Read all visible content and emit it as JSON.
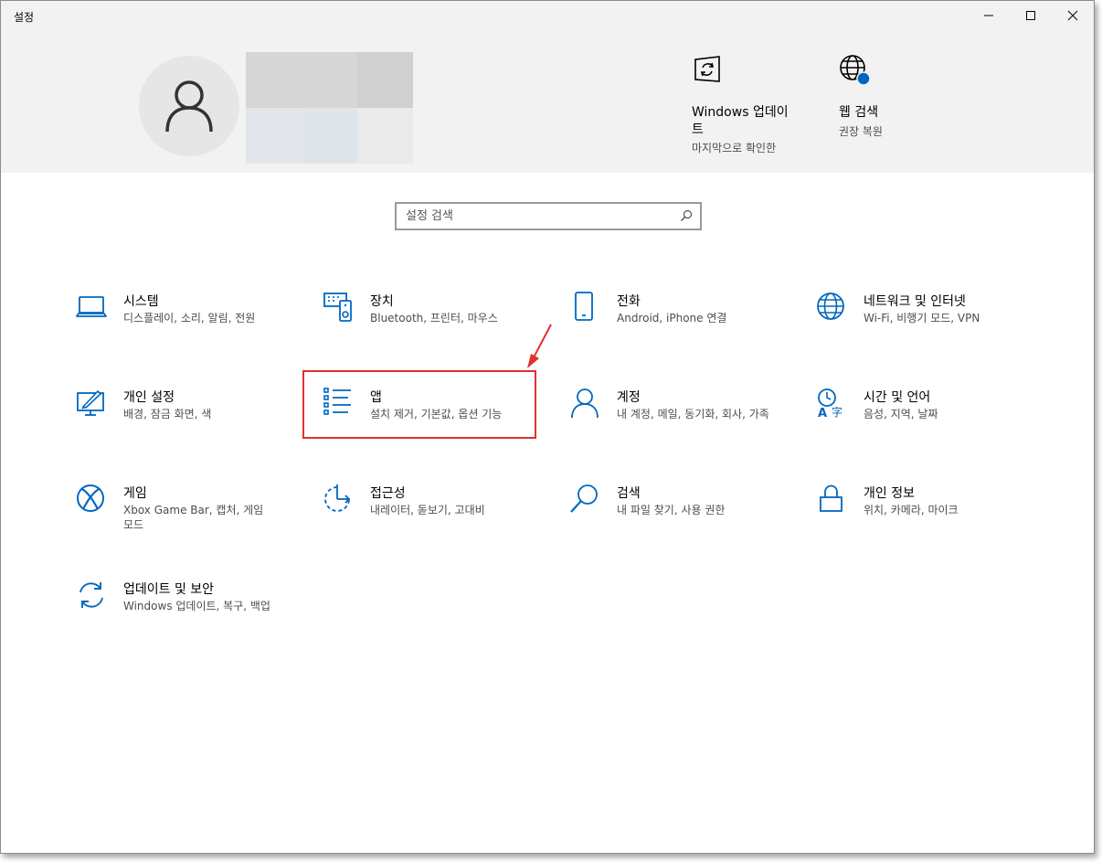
{
  "window": {
    "title": "설정"
  },
  "header": {
    "update": {
      "title": "Windows 업데이트",
      "subtitle": "마지막으로 확인한"
    },
    "web": {
      "title": "웹 검색",
      "subtitle": "권장 복원"
    }
  },
  "search": {
    "placeholder": "설정 검색"
  },
  "tiles": [
    {
      "name": "시스템",
      "desc": "디스플레이, 소리, 알림, 전원",
      "icon": "laptop-icon"
    },
    {
      "name": "장치",
      "desc": "Bluetooth, 프린터, 마우스",
      "icon": "devices-icon"
    },
    {
      "name": "전화",
      "desc": "Android, iPhone 연결",
      "icon": "phone-icon"
    },
    {
      "name": "네트워크 및 인터넷",
      "desc": "Wi-Fi, 비행기 모드, VPN",
      "icon": "globe-icon"
    },
    {
      "name": "개인 설정",
      "desc": "배경, 잠금 화면, 색",
      "icon": "personalization-icon"
    },
    {
      "name": "앱",
      "desc": "설치 제거, 기본값, 옵션 기능",
      "icon": "apps-list-icon"
    },
    {
      "name": "계정",
      "desc": "내 계정, 메일, 동기화, 회사, 가족",
      "icon": "person-icon"
    },
    {
      "name": "시간 및 언어",
      "desc": "음성, 지역, 날짜",
      "icon": "time-language-icon"
    },
    {
      "name": "게임",
      "desc": "Xbox Game Bar, 캡처, 게임 모드",
      "icon": "xbox-icon"
    },
    {
      "name": "접근성",
      "desc": "내레이터, 돋보기, 고대비",
      "icon": "ease-of-access-icon"
    },
    {
      "name": "검색",
      "desc": "내 파일 찾기, 사용 권한",
      "icon": "search-icon"
    },
    {
      "name": "개인 정보",
      "desc": "위치, 카메라, 마이크",
      "icon": "lock-icon"
    },
    {
      "name": "업데이트 및 보안",
      "desc": "Windows 업데이트, 복구, 백업",
      "icon": "sync-icon"
    }
  ],
  "colors": {
    "accent": "#0067c0",
    "highlight": "#e0312f",
    "header_bg": "#f2f2f2"
  }
}
